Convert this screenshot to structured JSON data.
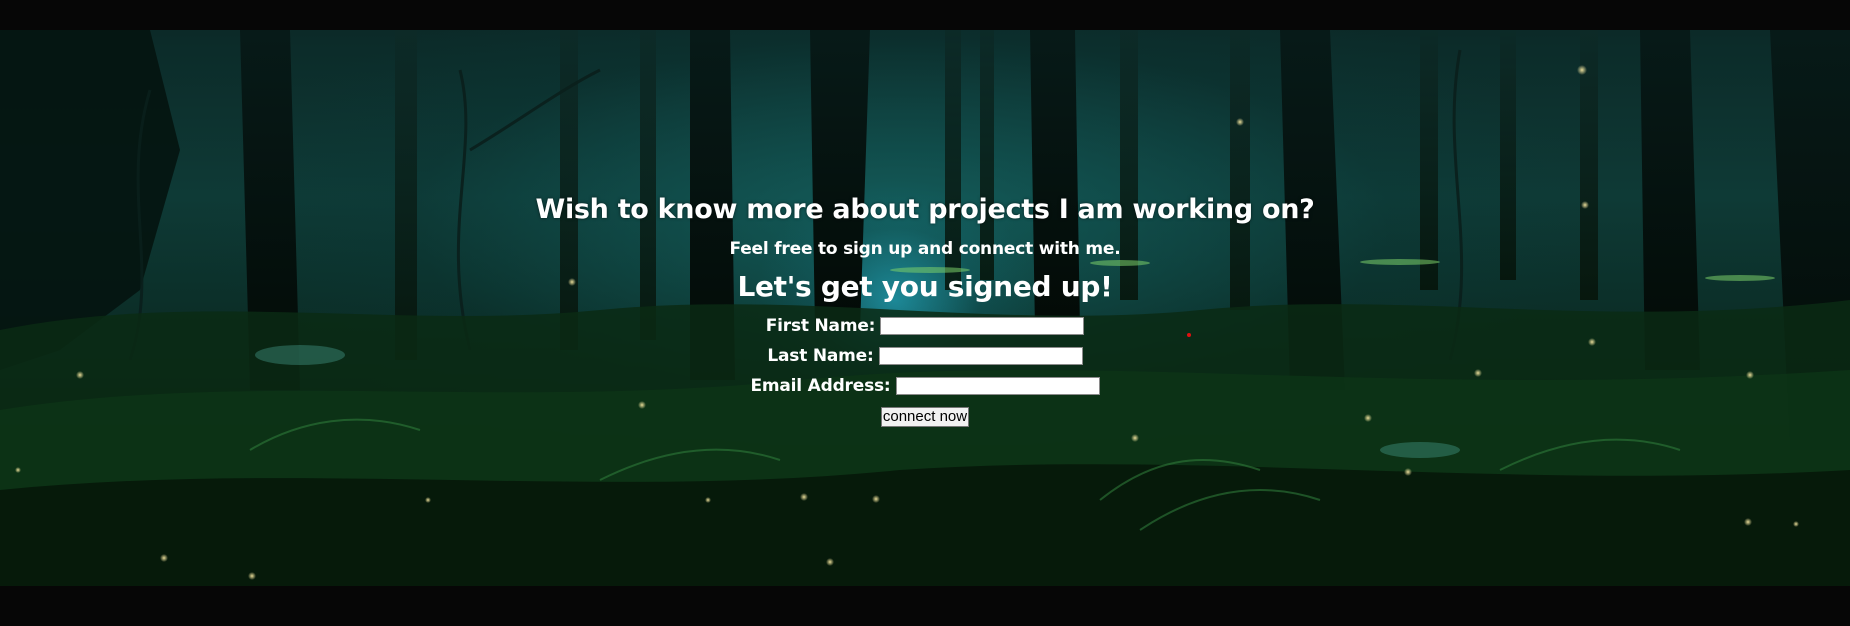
{
  "hero": {
    "question": "Wish to know more about projects I am working on?",
    "subtitle": "Feel free to sign up and connect with me.",
    "signup_heading": "Let's get you signed up!"
  },
  "form": {
    "first_name_label": "First Name:",
    "first_name_value": "",
    "last_name_label": "Last Name:",
    "last_name_value": "",
    "email_label": "Email Address:",
    "email_value": "",
    "submit_label": "connect now"
  },
  "background": {
    "description_icon": "forest-background-image"
  }
}
